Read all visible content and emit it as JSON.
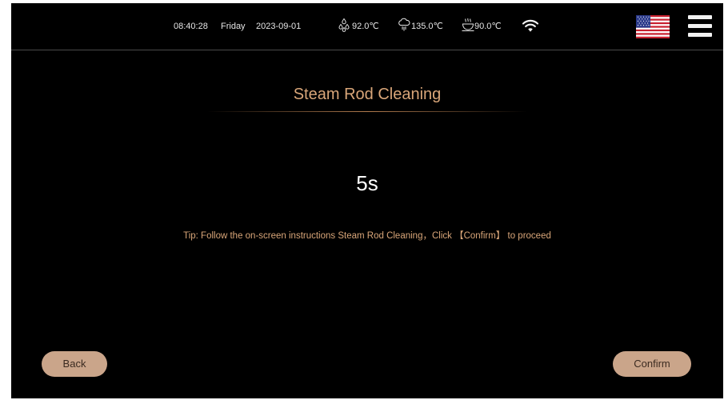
{
  "status_bar": {
    "time": "08:40:28",
    "day": "Friday",
    "date": "2023-09-01",
    "water_temp": "92.0℃",
    "steam_temp": "135.0℃",
    "group_temp": "90.0℃",
    "icons": {
      "water": "water-drops-icon",
      "steam": "steam-cloud-icon",
      "group": "coffee-cup-icon",
      "wifi": "wifi-icon",
      "language": "us-flag-icon",
      "menu": "hamburger-menu-icon"
    }
  },
  "page": {
    "title": "Steam Rod Cleaning",
    "countdown": "5s",
    "tip": "Tip: Follow the on-screen instructions Steam Rod Cleaning，Click 【Confirm】 to proceed"
  },
  "buttons": {
    "back_label": "Back",
    "confirm_label": "Confirm"
  },
  "colors": {
    "background": "#000000",
    "accent": "#d9a679",
    "button_fill": "#caa58a",
    "button_text": "#3a2a20",
    "status_text": "#e6e6e6"
  }
}
